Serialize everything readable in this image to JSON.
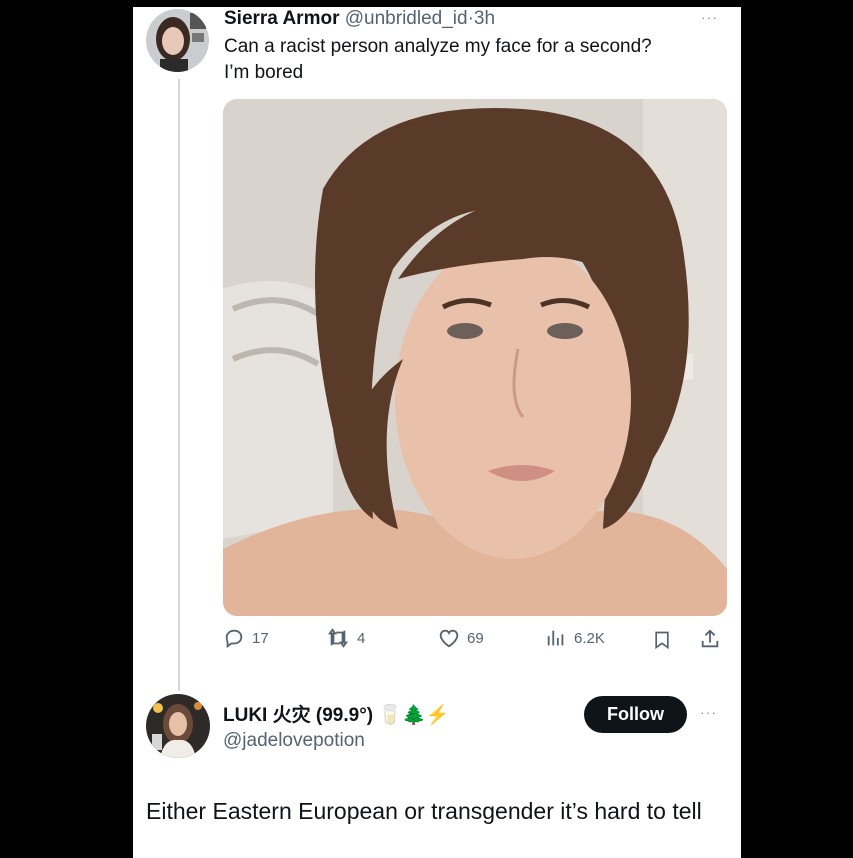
{
  "tweet": {
    "author_name": "Sierra Armor",
    "handle": "@unbridled_id",
    "separator": "·",
    "time": "3h",
    "text": "Can a racist person analyze my face for a second?\nI’m bored",
    "more_label": "···",
    "actions": {
      "replies": "17",
      "retweets": "4",
      "likes": "69",
      "views": "6.2K"
    }
  },
  "reply": {
    "author_name": "LUKI 火灾 (99.9°)",
    "emoji": "🥛🌲⚡",
    "handle": "@jadelovepotion",
    "follow_label": "Follow",
    "more_label": "···",
    "text": "Either Eastern European or transgender it’s hard to tell"
  },
  "colors": {
    "text_primary": "#0f1419",
    "text_secondary": "#536471",
    "thread_line": "#cfd9de",
    "follow_bg": "#0f1419",
    "page_background": "#000000",
    "panel_background": "#ffffff"
  },
  "icons": [
    "reply-icon",
    "retweet-icon",
    "like-icon",
    "views-icon",
    "bookmark-icon",
    "share-icon",
    "more-icon"
  ]
}
